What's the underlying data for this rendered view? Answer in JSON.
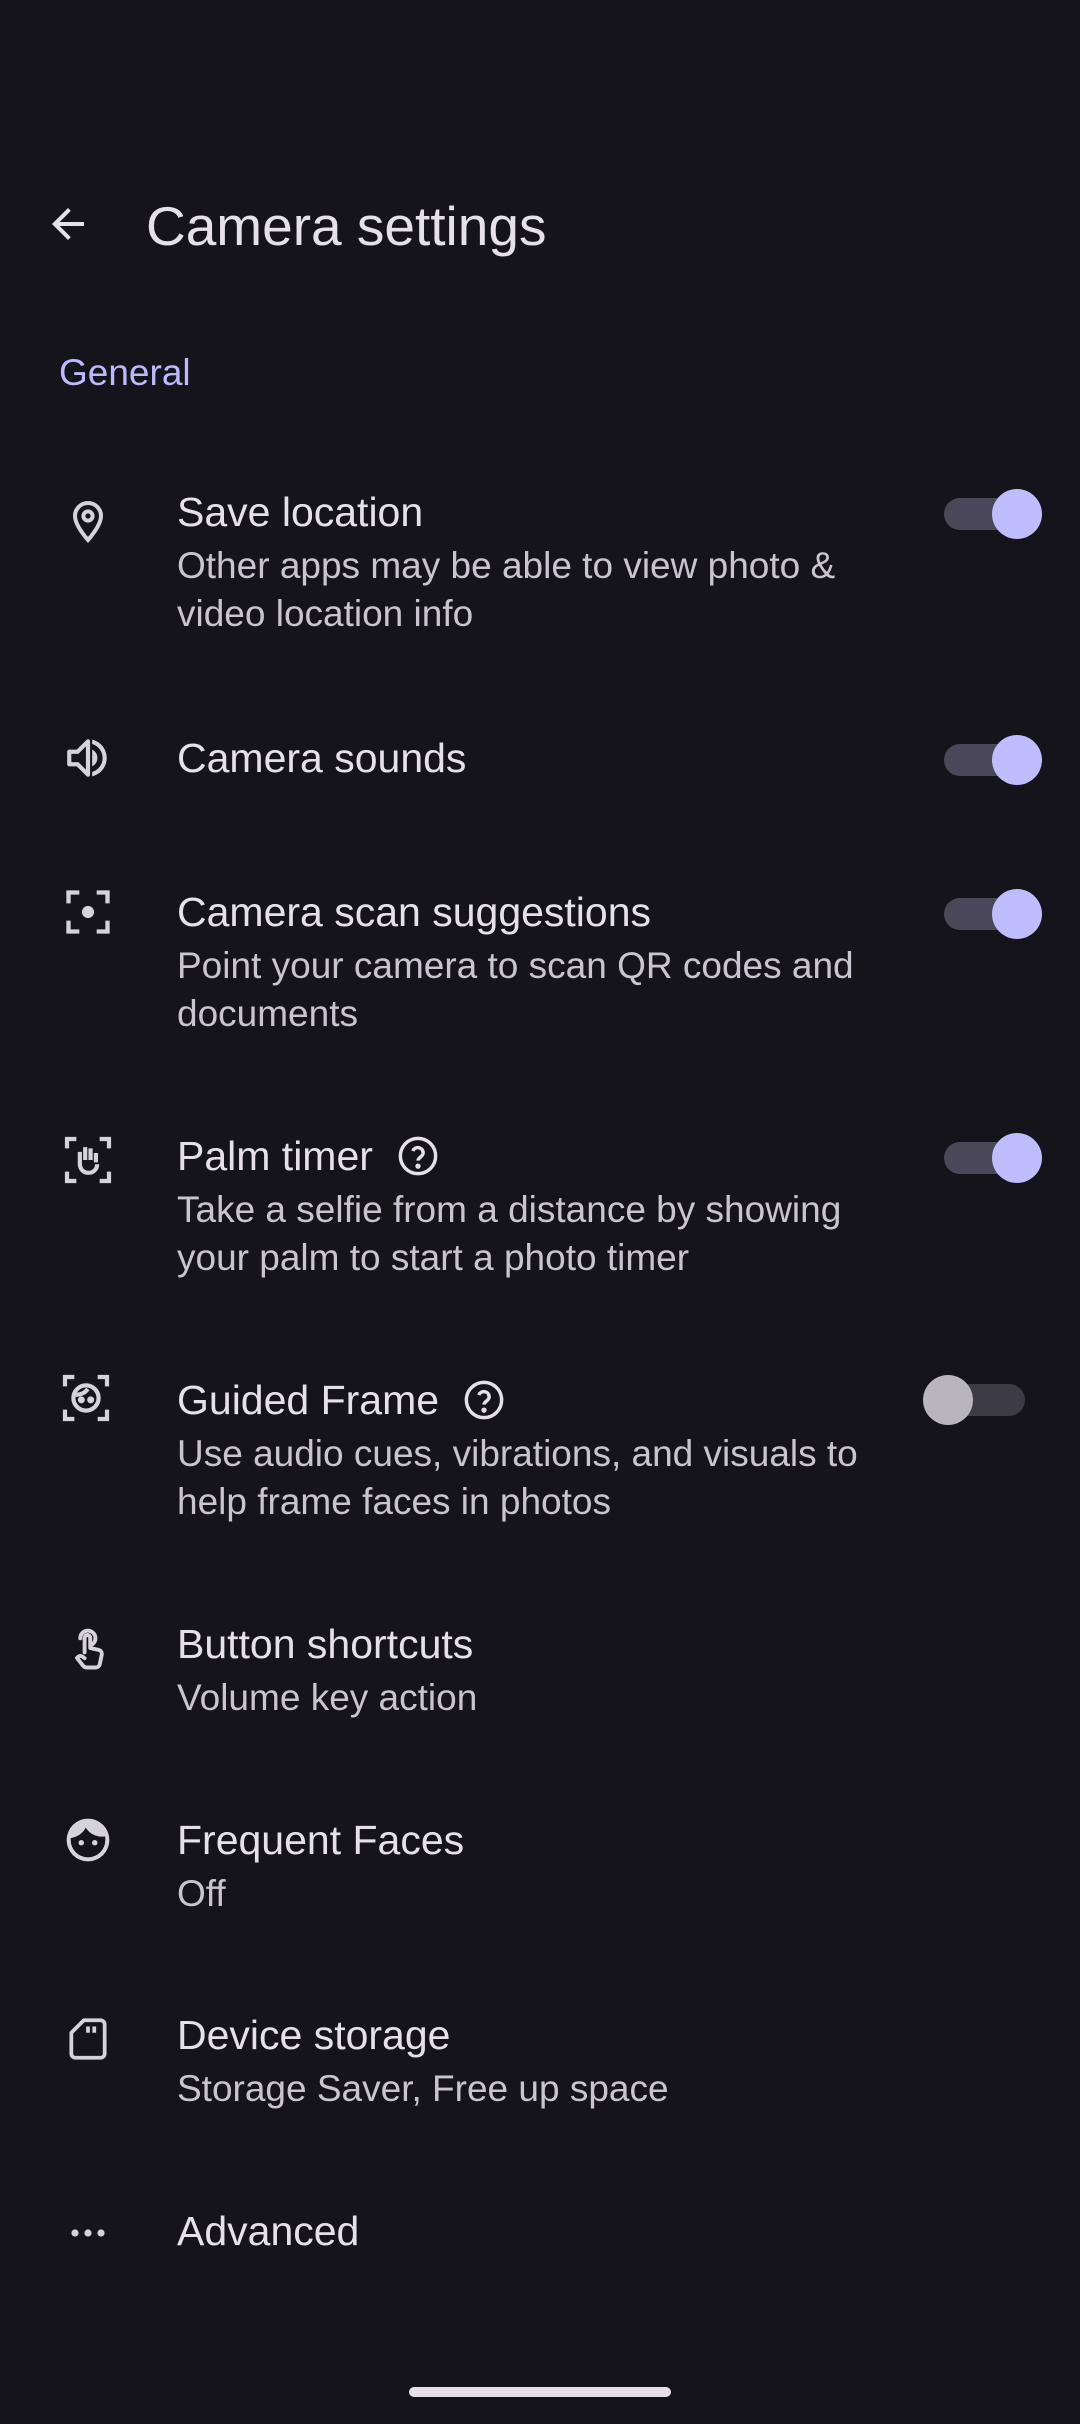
{
  "header": {
    "title": "Camera settings",
    "back_icon": "arrow-back-icon"
  },
  "section": {
    "title": "General"
  },
  "colors": {
    "background": "#15141a",
    "accent": "#bdb9ff",
    "switch_on_thumb": "#bdbdff",
    "text_primary": "#e6e1e9",
    "text_secondary": "#cac4d0"
  },
  "items": [
    {
      "icon": "location-pin-icon",
      "title": "Save location",
      "summary": "Other apps may be able to view photo & video location info",
      "toggle": true
    },
    {
      "icon": "speaker-icon",
      "title": "Camera sounds",
      "summary": "",
      "toggle": true
    },
    {
      "icon": "scan-focus-icon",
      "title": "Camera scan suggestions",
      "summary": "Point your camera to scan QR codes and documents",
      "toggle": true
    },
    {
      "icon": "palm-frame-icon",
      "title": "Palm timer",
      "summary": "Take a selfie from a distance by showing your palm to start a photo timer",
      "toggle": true,
      "help": true
    },
    {
      "icon": "face-frame-icon",
      "title": "Guided Frame",
      "summary": "Use audio cues, vibrations, and visuals to help frame faces in photos",
      "toggle": false,
      "help": true
    },
    {
      "icon": "touch-icon",
      "title": "Button shortcuts",
      "summary": "Volume key action"
    },
    {
      "icon": "face-icon",
      "title": "Frequent Faces",
      "summary": "Off"
    },
    {
      "icon": "sd-card-icon",
      "title": "Device storage",
      "summary": "Storage Saver, Free up space"
    },
    {
      "icon": "more-horiz-icon",
      "title": "Advanced",
      "summary": ""
    }
  ]
}
